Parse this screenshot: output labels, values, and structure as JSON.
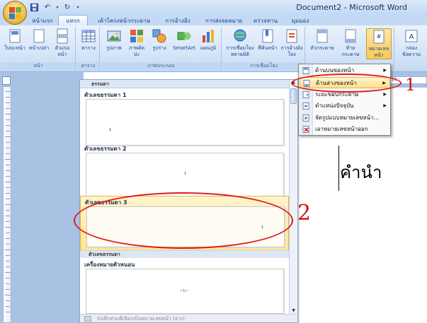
{
  "window": {
    "title": "Document2 - Microsoft Word"
  },
  "tabs": [
    {
      "label": "หน้าแรก"
    },
    {
      "label": "แทรก"
    },
    {
      "label": "เค้าโครงหน้ากระดาษ"
    },
    {
      "label": "การอ้างอิง"
    },
    {
      "label": "การส่งจดหมาย"
    },
    {
      "label": "ตรวจทาน"
    },
    {
      "label": "มุมมอง"
    }
  ],
  "ribbon": {
    "groups": [
      {
        "label": "หน้า"
      },
      {
        "label": "ตาราง"
      },
      {
        "label": "ภาพประกอบ"
      },
      {
        "label": "การเชื่อมโยง"
      }
    ],
    "buttons": {
      "cover_page": "ใบปะหน้า",
      "blank_page": "หน้าเปล่า",
      "page_break": "ตัวแบ่งหน้า",
      "table": "ตาราง",
      "picture": "รูปภาพ",
      "clip_art": "ภาพตัดปะ",
      "shapes": "รูปร่าง",
      "smartart": "SmartArt",
      "chart": "แผนภูมิ",
      "hyperlink": "การเชื่อมโยงหลายมิติ",
      "bookmark": "ที่คั่นหน้า",
      "cross_reference": "การอ้างอิงโยง",
      "header": "หัวกระดาษ",
      "footer": "ท้ายกระดาษ",
      "page_number": "หมายเลขหน้า",
      "text_box": "กล่องข้อความ"
    }
  },
  "gallery": {
    "header": "ธรรมดา",
    "items": [
      {
        "label": "ตัวเลขธรรมดา 1",
        "preview_text": "1"
      },
      {
        "label": "ตัวเลขธรรมดา 2",
        "preview_text": "1"
      },
      {
        "label": "ตัวเลขธรรมดา 3",
        "preview_text": "1"
      }
    ],
    "section_label": "ตัวเลขธรรมดา",
    "item4": {
      "label": "เครื่องหมายตัวหนอน",
      "preview_text": "~1~"
    },
    "footer": "บันทึกส่วนที่เลือกเป็นหมายเลขหน้า (ล่าง)"
  },
  "menu": {
    "items": [
      {
        "label": "ด้านบนของหน้า",
        "has_submenu": true
      },
      {
        "label": "ด้านล่างของหน้า",
        "has_submenu": true
      },
      {
        "label": "ระยะขอบกระดาษ",
        "has_submenu": true
      },
      {
        "label": "ตำแหน่งปัจจุบัน",
        "has_submenu": true
      },
      {
        "label": "จัดรูปแบบหมายเลขหน้า...",
        "has_submenu": false
      },
      {
        "label": "เอาหมายเลขหน้าออก",
        "has_submenu": false
      }
    ],
    "submenu_arrow": "▶"
  },
  "document": {
    "text": "คำนำ",
    "ruler_marks": "· 11 ·"
  },
  "annotations": {
    "one": "1",
    "two": "2"
  },
  "colors": {
    "ribbon": "#d3e3f7",
    "highlight": "#ffe08a",
    "annotation": "#e0191e",
    "panel": "#a9c2e4"
  }
}
